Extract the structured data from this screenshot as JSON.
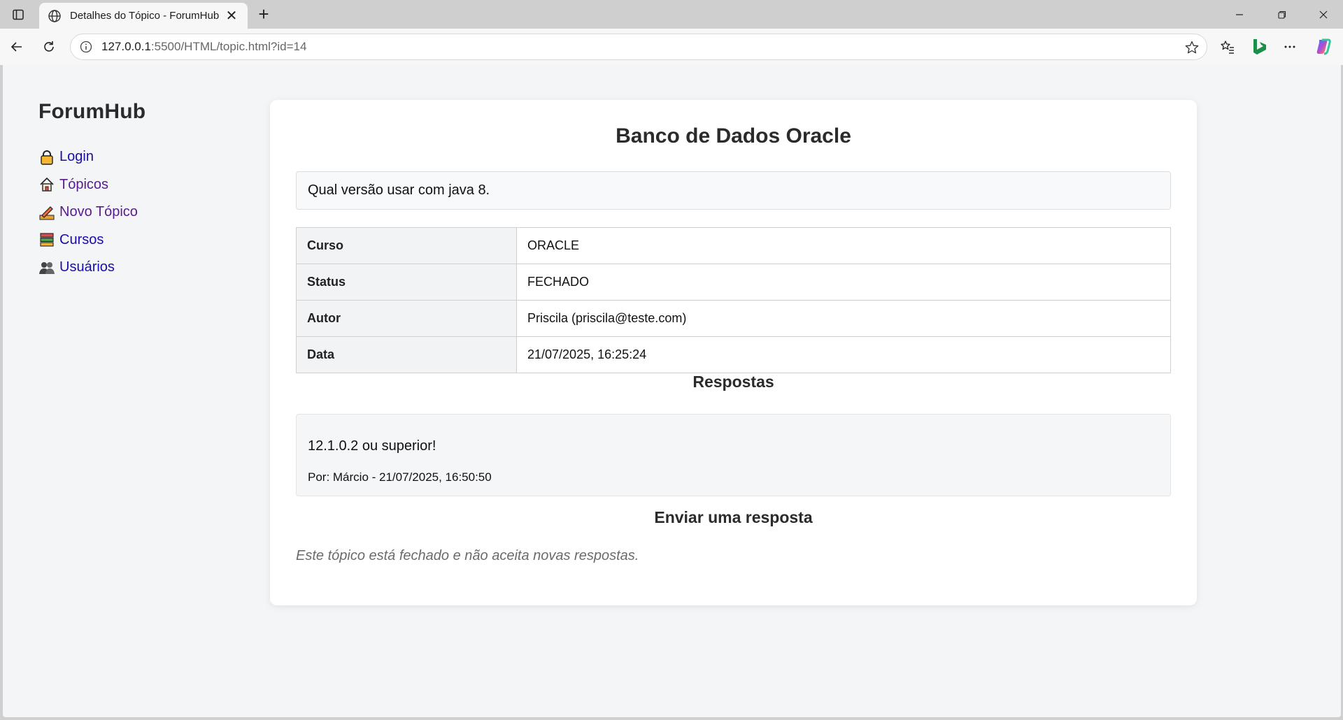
{
  "browser": {
    "tab_title": "Detalhes do Tópico - ForumHub",
    "tab_close": "✕",
    "new_tab": "+",
    "url_host": "127.0.0.1",
    "url_path": ":5500/HTML/topic.html?id=14"
  },
  "sidebar": {
    "brand": "ForumHub",
    "items": [
      {
        "label": "Login",
        "icon": "lock-icon"
      },
      {
        "label": "Tópicos",
        "icon": "house-icon"
      },
      {
        "label": "Novo Tópico",
        "icon": "pencil-icon"
      },
      {
        "label": "Cursos",
        "icon": "books-icon"
      },
      {
        "label": "Usuários",
        "icon": "users-icon"
      }
    ]
  },
  "topic": {
    "title": "Banco de Dados Oracle",
    "message": "Qual versão usar com java 8.",
    "details": [
      {
        "key": "Curso",
        "value": "ORACLE"
      },
      {
        "key": "Status",
        "value": "FECHADO"
      },
      {
        "key": "Autor",
        "value": "Priscila (priscila@teste.com)"
      },
      {
        "key": "Data",
        "value": "21/07/2025, 16:25:24"
      }
    ]
  },
  "replies": {
    "heading": "Respostas",
    "items": [
      {
        "text": "12.1.0.2 ou superior!",
        "meta": "Por: Márcio - 21/07/2025, 16:50:50"
      }
    ]
  },
  "reply_form": {
    "heading": "Enviar uma resposta",
    "closed_note": "Este tópico está fechado e não aceita novas respostas."
  }
}
